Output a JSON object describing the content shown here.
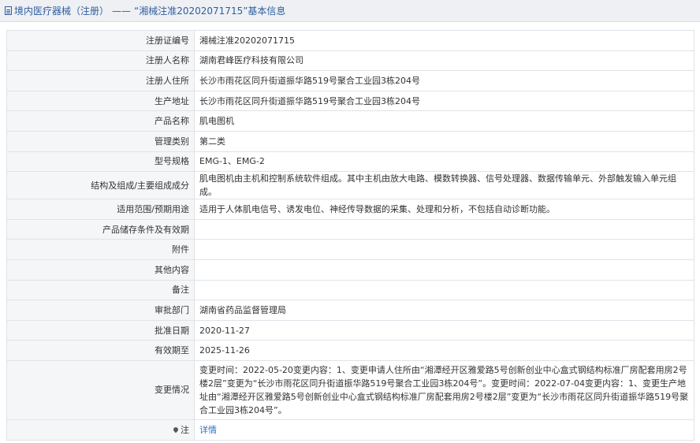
{
  "header": {
    "category": "境内医疗器械（注册）",
    "separator": "——",
    "title": "“湘械注准20202071715”基本信息"
  },
  "rows": [
    {
      "label": "注册证编号",
      "value": "湘械注准20202071715"
    },
    {
      "label": "注册人名称",
      "value": "湖南君峰医疗科技有限公司"
    },
    {
      "label": "注册人住所",
      "value": "长沙市雨花区同升街道振华路519号聚合工业园3栋204号"
    },
    {
      "label": "生产地址",
      "value": "长沙市雨花区同升街道振华路519号聚合工业园3栋204号"
    },
    {
      "label": "产品名称",
      "value": "肌电图机"
    },
    {
      "label": "管理类别",
      "value": "第二类"
    },
    {
      "label": "型号规格",
      "value": "EMG-1、EMG-2"
    },
    {
      "label": "结构及组成/主要组成成分",
      "value": "肌电图机由主机和控制系统软件组成。其中主机由放大电路、模数转换器、信号处理器、数据传输单元、外部触发输入单元组成。"
    },
    {
      "label": "适用范围/预期用途",
      "value": "适用于人体肌电信号、诱发电位、神经传导数据的采集、处理和分析，不包括自动诊断功能。"
    },
    {
      "label": "产品储存条件及有效期",
      "value": ""
    },
    {
      "label": "附件",
      "value": ""
    },
    {
      "label": "其他内容",
      "value": ""
    },
    {
      "label": "备注",
      "value": ""
    },
    {
      "label": "审批部门",
      "value": "湖南省药品监督管理局"
    },
    {
      "label": "批准日期",
      "value": "2020-11-27"
    },
    {
      "label": "有效期至",
      "value": "2025-11-26"
    },
    {
      "label": "变更情况",
      "value": "变更时间：2022-05-20变更内容：1、变更申请人住所由“湘潭经开区雅爱路5号创新创业中心盒式钢结构标准厂房配套用房2号楼2层”变更为“长沙市雨花区同升街道振华路519号聚合工业园3栋204号”。变更时间：2022-07-04变更内容：1、变更生产地址由“湘潭经开区雅爱路5号创新创业中心盒式钢结构标准厂房配套用房2号楼2层”变更为“长沙市雨花区同升街道振华路519号聚合工业园3栋204号”。"
    }
  ],
  "note": {
    "label": "注",
    "link_text": "详情",
    "icon": "map-pin-icon"
  }
}
